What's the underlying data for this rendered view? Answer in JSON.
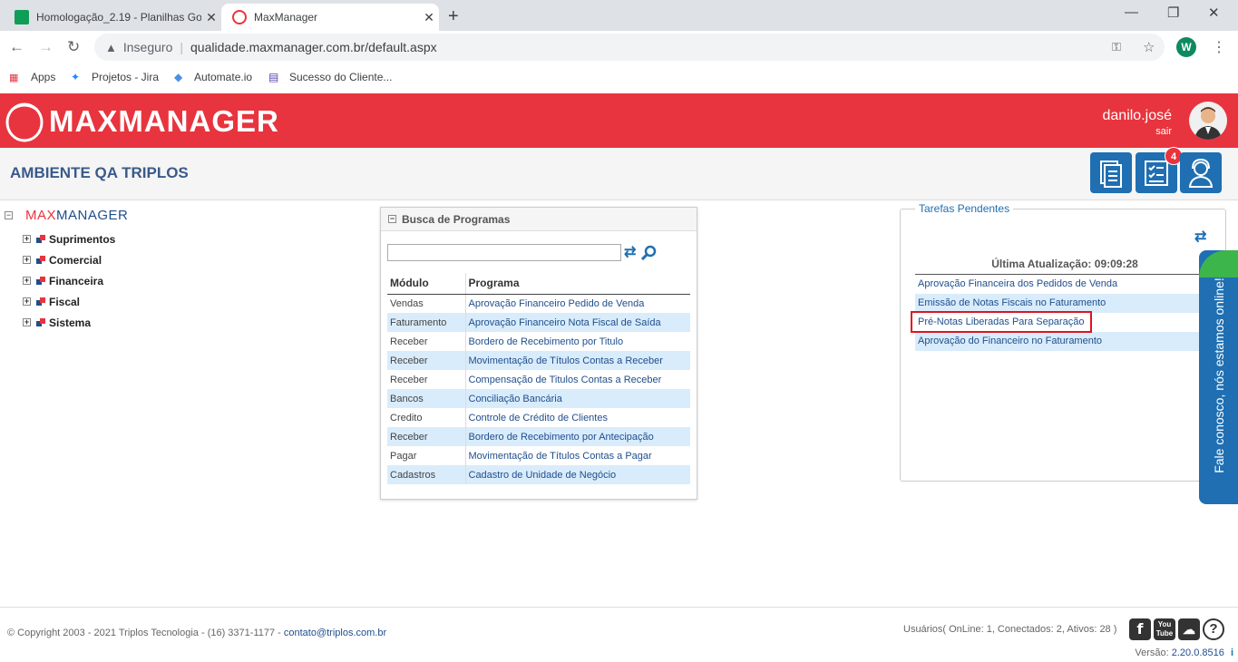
{
  "browser": {
    "tab1_title": "Homologação_2.19 - Planilhas Go",
    "tab2_title": "MaxManager",
    "security_label": "Inseguro",
    "url": "qualidade.maxmanager.com.br/default.aspx",
    "profile_initial": "W",
    "bookmarks": [
      "Apps",
      "Projetos - Jira",
      "Automate.io",
      "Sucesso do Cliente..."
    ]
  },
  "header": {
    "logo": "MAXMANAGER",
    "username": "danilo.josé",
    "logout": "sair"
  },
  "subheader": {
    "environment": "AMBIENTE QA TRIPLOS",
    "notification_count": "4"
  },
  "tree": {
    "root_max": "MAX",
    "root_manager": "MANAGER",
    "items": [
      "Suprimentos",
      "Comercial",
      "Financeira",
      "Fiscal",
      "Sistema"
    ]
  },
  "search_panel": {
    "title": "Busca de Programas",
    "search_value": "",
    "col_module": "Módulo",
    "col_program": "Programa",
    "rows": [
      {
        "module": "Vendas",
        "program": "Aprovação Financeiro Pedido de Venda"
      },
      {
        "module": "Faturamento",
        "program": "Aprovação Financeiro Nota Fiscal de Saída"
      },
      {
        "module": "Receber",
        "program": "Bordero de Recebimento por Titulo"
      },
      {
        "module": "Receber",
        "program": "Movimentação de Títulos Contas a Receber"
      },
      {
        "module": "Receber",
        "program": "Compensação de Titulos Contas a Receber"
      },
      {
        "module": "Bancos",
        "program": "Conciliação Bancária"
      },
      {
        "module": "Credito",
        "program": "Controle de Crédito de Clientes"
      },
      {
        "module": "Receber",
        "program": "Bordero de Recebimento por Antecipação"
      },
      {
        "module": "Pagar",
        "program": "Movimentação de Títulos Contas a Pagar"
      },
      {
        "module": "Cadastros",
        "program": "Cadastro de Unidade de Negócio"
      }
    ]
  },
  "tasks": {
    "title": "Tarefas Pendentes",
    "last_update": "Última Atualização: 09:09:28",
    "items": [
      "Aprovação Financeira dos Pedidos de Venda",
      "Emissão de Notas Fiscais no Faturamento",
      "Pré-Notas Liberadas Para Separação",
      "Aprovação do Financeiro no Faturamento"
    ]
  },
  "chat": {
    "label": "Fale conosco, nós estamos online!"
  },
  "footer": {
    "copyright": "© Copyright 2003 - 2021 Triplos Tecnologia - (16) 3371-1177 - ",
    "email": "contato@triplos.com.br",
    "users": "Usuários( OnLine: 1, Conectados: 2, Ativos: 28 )",
    "version_label": "Versão:",
    "version": "2.20.0.8516",
    "youtube": "You Tube"
  },
  "colors": {
    "brand_red": "#e8343e",
    "accent_blue": "#1f6fb2",
    "row_alt": "#d9ecfb",
    "highlight": "#e0141e"
  }
}
